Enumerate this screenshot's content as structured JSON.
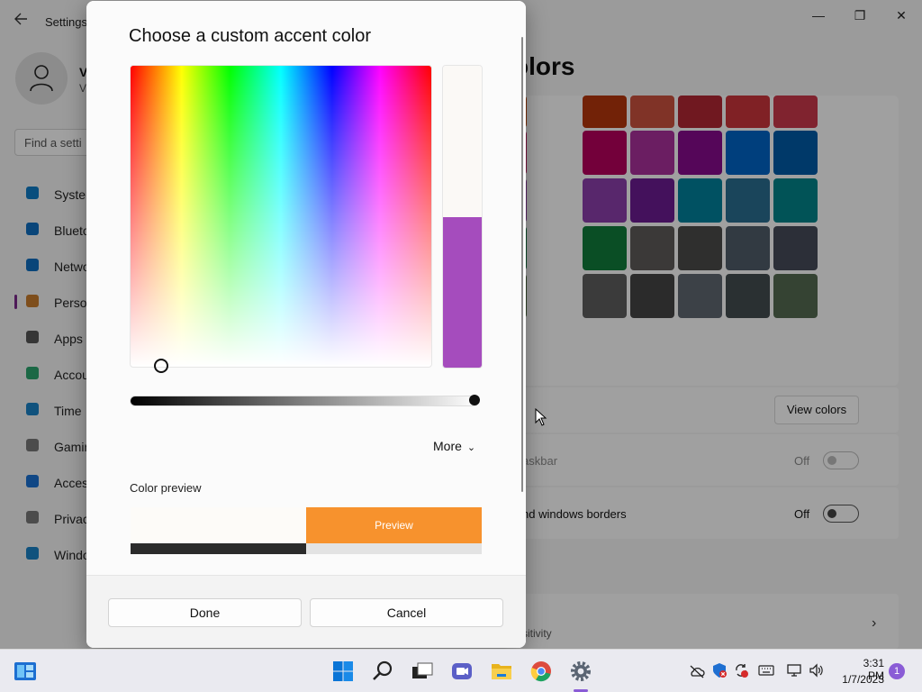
{
  "window": {
    "title": "Settings",
    "minimize": "—",
    "maximize": "❐",
    "close": "✕"
  },
  "user": {
    "name": "V",
    "sub": "V"
  },
  "search": {
    "placeholder": "Find a setti"
  },
  "sidebar": {
    "items": [
      {
        "label": "Syster",
        "icon": "system-icon",
        "color": "#0f7bc4"
      },
      {
        "label": "Blueto",
        "icon": "bluetooth-icon",
        "color": "#0f6cbd"
      },
      {
        "label": "Netwo",
        "icon": "wifi-icon",
        "color": "#0f6cbd"
      },
      {
        "label": "Perso",
        "icon": "brush-icon",
        "color": "#c67b2d"
      },
      {
        "label": "Apps",
        "icon": "apps-icon",
        "color": "#555"
      },
      {
        "label": "Accou",
        "icon": "account-icon",
        "color": "#2ba36c"
      },
      {
        "label": "Time",
        "icon": "time-language-icon",
        "color": "#1a80c4"
      },
      {
        "label": "Gamin",
        "icon": "gaming-icon",
        "color": "#777"
      },
      {
        "label": "Acces",
        "icon": "accessibility-icon",
        "color": "#1a6fd0"
      },
      {
        "label": "Privac",
        "icon": "shield-icon",
        "color": "#777"
      },
      {
        "label": "Windo",
        "icon": "windows-update-icon",
        "color": "#1a80c4"
      }
    ]
  },
  "page": {
    "heading": "olors",
    "swatches": [
      [
        "#c2470b",
        "#b3360b",
        "#c8503e",
        "#b02732",
        "#c8343a",
        "#c9384a"
      ],
      [
        "#c0195e",
        "#b5005c",
        "#a8309a",
        "#860a8c",
        "#0063c4",
        "#005aa5"
      ],
      [
        "#8f39a2",
        "#8a3ea9",
        "#6b1b90",
        "#007f9a",
        "#2a6c8f",
        "#038389"
      ],
      [
        "#11773f",
        "#107a3a",
        "#5d5a58",
        "#4a4a48",
        "#4f5b68",
        "#454a58"
      ],
      [
        "#4a6a3e",
        "#5d5d5d",
        "#444444",
        "#5e6770",
        "#424b4f",
        "#536a50"
      ]
    ],
    "view_colors_label": "View colors",
    "taskbar_row_text": "askbar",
    "taskbar_row_state": "Off",
    "borders_row_text": "nd windows borders",
    "borders_row_state": "Off",
    "bottom_row_text": "sitivity"
  },
  "dialog": {
    "title": "Choose a custom accent color",
    "more_label": "More",
    "color_preview_label": "Color preview",
    "preview_text": "Preview",
    "done_label": "Done",
    "cancel_label": "Cancel",
    "selected_color": "#a54cbd",
    "preview_color": "#f7922d",
    "value_level": 1.0
  },
  "taskbar": {
    "icons": [
      "widgets-icon",
      "start-icon",
      "search-icon",
      "task-view-icon",
      "chat-icon",
      "file-explorer-icon",
      "chrome-icon",
      "settings-icon"
    ],
    "clock_time": "3:31 PM",
    "clock_date": "1/7/2023",
    "notification_count": "1"
  }
}
